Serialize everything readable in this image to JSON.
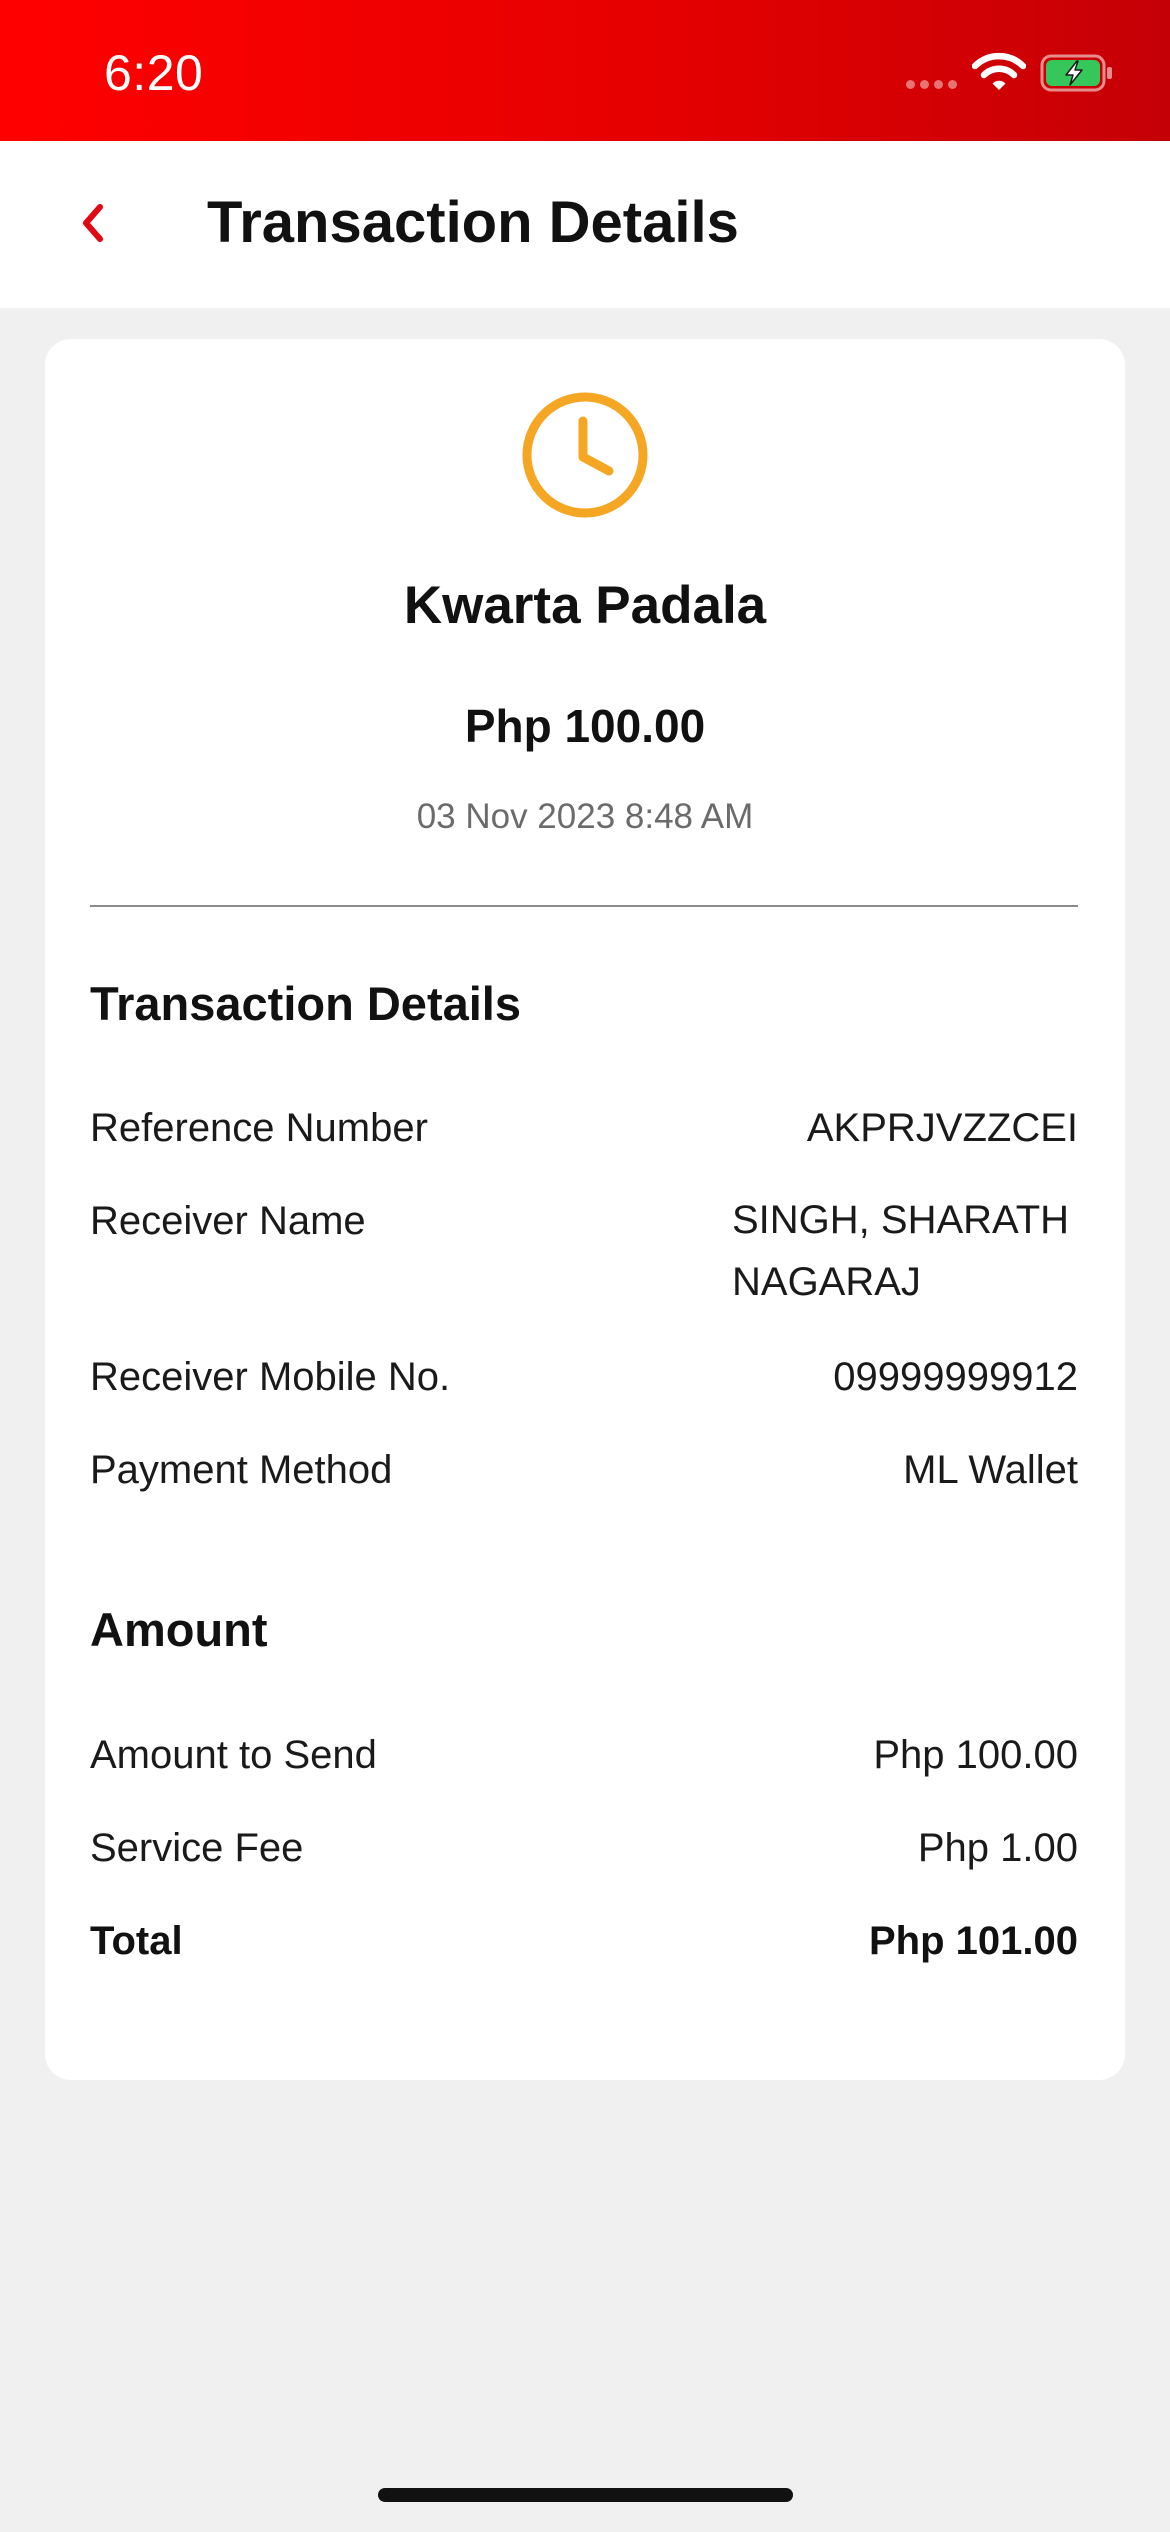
{
  "status_bar": {
    "time": "6:20",
    "background_colors": [
      "#ff0000",
      "#c40006"
    ],
    "icons": [
      "signal-dots-icon",
      "wifi-icon",
      "battery-charging-icon"
    ],
    "battery_color": "#35c759"
  },
  "header": {
    "title": "Transaction Details",
    "back_icon": "chevron-left-icon",
    "accent_color": "#e30613"
  },
  "summary": {
    "status_icon": "clock-icon",
    "status_color": "#f5a623",
    "service_name": "Kwarta Padala",
    "amount": "Php 100.00",
    "date": "03 Nov 2023 8:48 AM"
  },
  "transaction_details": {
    "title": "Transaction Details",
    "rows": [
      {
        "label": "Reference Number",
        "value": "AKPRJVZZCEI"
      },
      {
        "label": "Receiver Name",
        "value": "SINGH, SHARATH NAGARAJ"
      },
      {
        "label": "Receiver Mobile No.",
        "value": "09999999912"
      },
      {
        "label": "Payment Method",
        "value": "ML Wallet"
      }
    ]
  },
  "amount": {
    "title": "Amount",
    "rows": [
      {
        "label": "Amount to Send",
        "value": "Php 100.00"
      },
      {
        "label": "Service Fee",
        "value": "Php 1.00"
      },
      {
        "label": "Total",
        "value": "Php 101.00"
      }
    ]
  }
}
